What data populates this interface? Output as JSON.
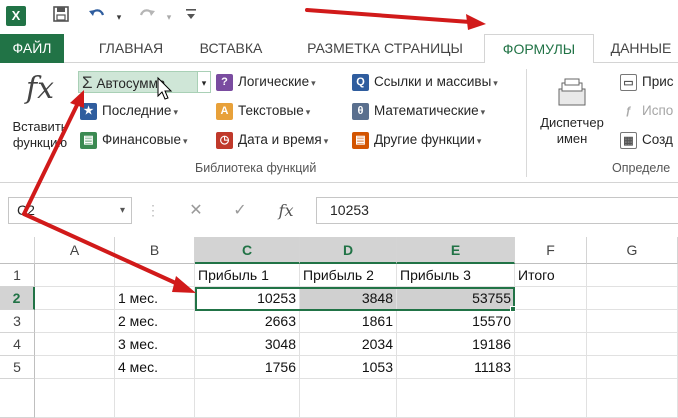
{
  "title_bar": {
    "app_icon": "X",
    "save_icon": "save-icon",
    "undo_icon": "undo-icon",
    "redo_icon": "redo-icon",
    "customize_icon": "customize-icon"
  },
  "tabs": [
    {
      "label": "ФАЙЛ"
    },
    {
      "label": "ГЛАВНАЯ"
    },
    {
      "label": "ВСТАВКА"
    },
    {
      "label": "РАЗМЕТКА СТРАНИЦЫ"
    },
    {
      "label": "ФОРМУЛЫ"
    },
    {
      "label": "ДАННЫЕ"
    }
  ],
  "ribbon": {
    "insert_function": {
      "icon": "fx",
      "line1": "Вставить",
      "line2": "функцию"
    },
    "autosum": "Автосумма",
    "recent": "Последние",
    "financial": "Финансовые",
    "logical": "Логические",
    "text": "Текстовые",
    "datetime": "Дата и время",
    "lookup": "Ссылки и массивы",
    "math": "Математические",
    "other": "Другие функции",
    "name_manager": {
      "line1": "Диспетчер",
      "line2": "имен"
    },
    "define_name": "Прис",
    "use_in_formula": "Испо",
    "create_from_selection": "Созд",
    "library_label": "Библиотека функций",
    "defined_names_label": "Определе"
  },
  "formula_bar": {
    "name_box": "C2",
    "cancel": "✕",
    "enter": "✓",
    "fx": "fx",
    "value": "10253"
  },
  "columns": [
    "A",
    "B",
    "C",
    "D",
    "E",
    "F",
    "G"
  ],
  "rows": [
    "1",
    "2",
    "3",
    "4",
    "5"
  ],
  "cells": {
    "C1": "Прибыль 1",
    "D1": "Прибыль 2",
    "E1": "Прибыль 3",
    "F1": "Итого",
    "B2": "1 мес.",
    "C2": "10253",
    "D2": "3848",
    "E2": "53755",
    "B3": "2 мес.",
    "C3": "2663",
    "D3": "1861",
    "E3": "15570",
    "B4": "3 мес.",
    "C4": "3048",
    "D4": "2034",
    "E4": "19186",
    "B5": "4 мес.",
    "C5": "1756",
    "D5": "1053",
    "E5": "11183"
  },
  "colors": {
    "accent": "#217346",
    "annotation": "#d11a1a"
  }
}
